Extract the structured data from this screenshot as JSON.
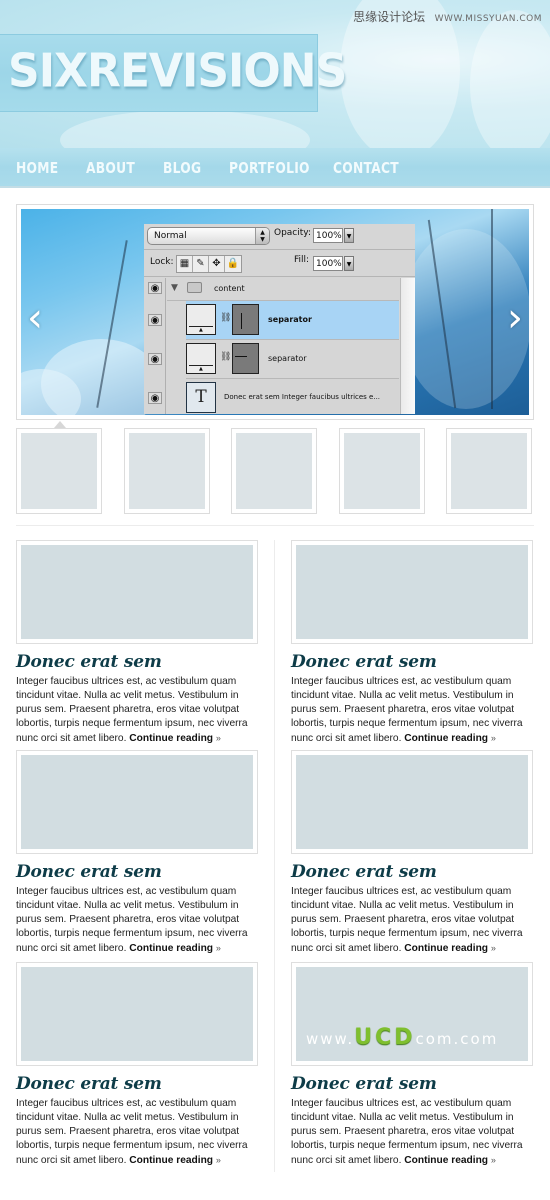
{
  "watermark": {
    "chinese": "思缘设计论坛",
    "url": "WWW.MISSYUAN.COM"
  },
  "header": {
    "logo": "SIXREVISIONS"
  },
  "nav": {
    "items": [
      "HOME",
      "ABOUT",
      "BLOG",
      "PORTFOLIO",
      "CONTACT"
    ]
  },
  "slider": {
    "prev_icon": "‹",
    "next_icon": "›",
    "layers_panel": {
      "blend_mode": "Normal",
      "opacity_label": "Opacity:",
      "opacity_value": "100%",
      "lock_label": "Lock:",
      "fill_label": "Fill:",
      "fill_value": "100%",
      "layers": [
        {
          "name": "content",
          "type": "group",
          "selected": false
        },
        {
          "name": "separator",
          "type": "shape",
          "selected": true
        },
        {
          "name": "separator",
          "type": "shape",
          "selected": false
        },
        {
          "name": "Donec erat sem Integer faucibus ultrices e...",
          "type": "text",
          "selected": false
        }
      ]
    },
    "thumbnail_count": 5
  },
  "posts": [
    {
      "title": "Donec erat sem",
      "body": "Integer faucibus ultrices est, ac vestibulum quam tincidunt vitae. Nulla ac velit metus. Vestibulum in purus sem. Praesent pharetra, eros vitae volutpat lobortis, turpis neque fermentum ipsum, nec viverra nunc orci sit amet libero.",
      "link": "Continue reading",
      "raquo": "»"
    },
    {
      "title": "Donec erat sem",
      "body": "Integer faucibus ultrices est, ac vestibulum quam tincidunt vitae. Nulla ac velit metus. Vestibulum in purus sem. Praesent pharetra, eros vitae volutpat lobortis, turpis neque fermentum ipsum, nec viverra nunc orci sit amet libero.",
      "link": "Continue reading",
      "raquo": "»"
    },
    {
      "title": "Donec erat sem",
      "body": "Integer faucibus ultrices est, ac vestibulum quam tincidunt vitae. Nulla ac velit metus. Vestibulum in purus sem. Praesent pharetra, eros vitae volutpat lobortis, turpis neque fermentum ipsum, nec viverra nunc orci sit amet libero.",
      "link": "Continue reading",
      "raquo": "»"
    },
    {
      "title": "Donec erat sem",
      "body": "Integer faucibus ultrices est, ac vestibulum quam tincidunt vitae. Nulla ac velit metus. Vestibulum in purus sem. Praesent pharetra, eros vitae volutpat lobortis, turpis neque fermentum ipsum, nec viverra nunc orci sit amet libero.",
      "link": "Continue reading",
      "raquo": "»"
    },
    {
      "title": "Donec erat sem",
      "body": "Integer faucibus ultrices est, ac vestibulum quam tincidunt vitae. Nulla ac velit metus. Vestibulum in purus sem. Praesent pharetra, eros vitae volutpat lobortis, turpis neque fermentum ipsum, nec viverra nunc orci sit amet libero.",
      "link": "Continue reading",
      "raquo": "»"
    },
    {
      "title": "Donec erat sem",
      "body": "Integer faucibus ultrices est, ac vestibulum quam tincidunt vitae. Nulla ac velit metus. Vestibulum in purus sem. Praesent pharetra, eros vitae volutpat lobortis, turpis neque fermentum ipsum, nec viverra nunc orci sit amet libero.",
      "link": "Continue reading",
      "raquo": "»"
    }
  ],
  "overlay_watermark": {
    "prefix": "www.",
    "brand": "UCD",
    "suffix": "com.com"
  },
  "colors": {
    "heading": "#0e3c48",
    "nav_bg": "#a4d8e9",
    "selected_layer": "#a8d4f5",
    "placeholder": "#d2dde1"
  }
}
